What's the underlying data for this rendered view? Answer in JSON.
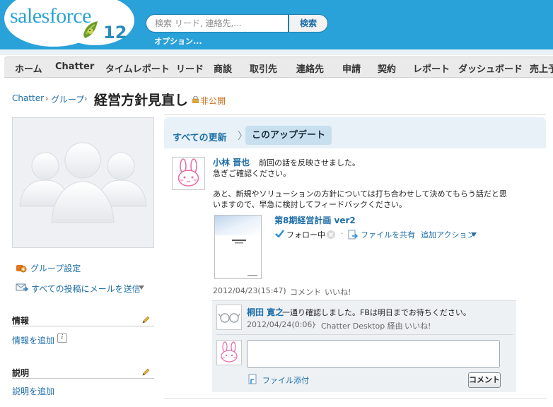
{
  "header": {
    "logo_text": "salesforce",
    "logo_version": "12",
    "search_placeholder": "検索 リード, 連絡先,...",
    "search_button": "検索",
    "options_link": "オプション..."
  },
  "tabs": [
    "ホーム",
    "Chatter",
    "タイムレポート",
    "リード",
    "商談",
    "取引先",
    "連絡先",
    "申請",
    "契約",
    "レポート",
    "ダッシュボード",
    "売上予"
  ],
  "breadcrumb": {
    "items": [
      "Chatter",
      "グループ"
    ],
    "title": "経営方針見直し",
    "privacy": "非公開"
  },
  "sidebar": {
    "group_settings": "グループ設定",
    "email_all": "すべての投稿にメールを送信",
    "info_heading": "情報",
    "add_info": "情報を追加",
    "desc_heading": "説明",
    "add_desc": "説明を追加"
  },
  "feed": {
    "filter_all": "すべての更新",
    "filter_current": "このアップデート"
  },
  "post": {
    "author": "小林 晋也",
    "line1": "前回の話を反映させました。",
    "line2": "急ぎご確認ください。",
    "line3": "あと、新規やソリューションの方針については打ち合わせして決めてもらう話だと思",
    "line4": "いますので、早急に検討してフィードバックください。",
    "file_name": "第8期経営計画 ver2",
    "following": "フォロー中",
    "share_file": "ファイルを共有",
    "more_actions": "追加アクション",
    "timestamp": "2012/04/23(15:47)",
    "comment_link": "コメント",
    "like_link": "いいね!",
    "dot": "·"
  },
  "comment": {
    "author": "桐田 寛之",
    "text": "一通り確認しました。FBは明日までお待ちください。",
    "timestamp": "2012/04/24(0:06)",
    "via": "Chatter Desktop 経由",
    "like_link": "いいね!",
    "attach": "ファイル添付",
    "button": "コメント"
  }
}
